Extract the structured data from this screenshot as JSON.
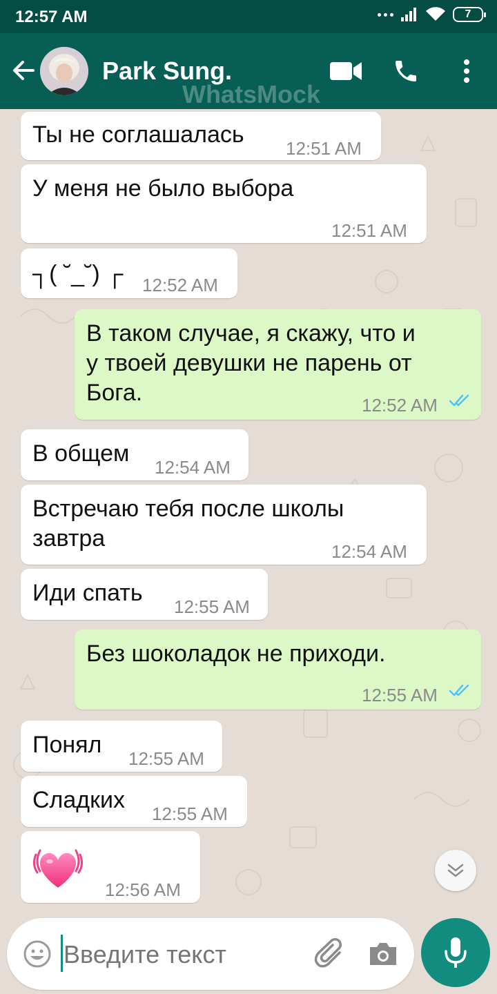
{
  "status_bar": {
    "time": "12:57 AM",
    "battery": "7"
  },
  "header": {
    "contact_name": "Park Sung.",
    "watermark": "WhatsMock"
  },
  "messages": [
    {
      "direction": "in",
      "text": "Ты не соглашалась",
      "time": "12:51 AM"
    },
    {
      "direction": "in",
      "text": "У меня не было выбора",
      "time": "12:51 AM"
    },
    {
      "direction": "in",
      "text": "┐( ˘_˘) ┌",
      "time": "12:52 AM"
    },
    {
      "direction": "out",
      "text_lines": [
        "В таком случае, я скажу, что и",
        "у твоей девушки не парень от",
        "Бога."
      ],
      "time": "12:52 AM",
      "status": "read"
    },
    {
      "direction": "in",
      "text": "В общем",
      "time": "12:54 AM"
    },
    {
      "direction": "in",
      "text_lines": [
        "Встречаю тебя после школы",
        "завтра"
      ],
      "time": "12:54 AM"
    },
    {
      "direction": "in",
      "text": "Иди спать",
      "time": "12:55 AM"
    },
    {
      "direction": "out",
      "text": "Без шоколадок не приходи.",
      "time": "12:55 AM",
      "status": "read"
    },
    {
      "direction": "in",
      "text": "Понял",
      "time": "12:55 AM"
    },
    {
      "direction": "in",
      "text": "Сладких",
      "time": "12:55 AM"
    },
    {
      "direction": "in",
      "emoji": "beating-heart",
      "time": "12:56 AM"
    }
  ],
  "composer": {
    "placeholder": "Введите текст"
  },
  "colors": {
    "header": "#075e54",
    "status_bar": "#054d44",
    "outgoing_bubble": "#dcf8c6",
    "accent": "#128c7e",
    "read_tick": "#4fc3f7"
  }
}
